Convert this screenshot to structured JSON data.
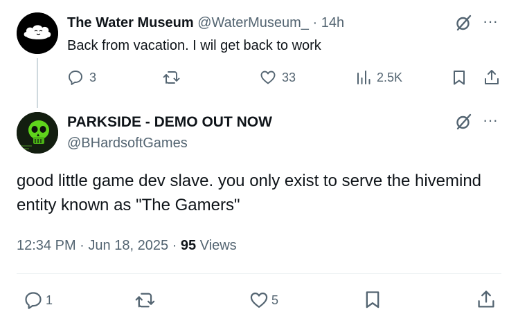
{
  "tweet1": {
    "display_name": "The Water Museum",
    "handle": "@WaterMuseum_",
    "separator": "·",
    "time": "14h",
    "text": "Back from vacation. I wil get back to work",
    "replies": "3",
    "likes": "33",
    "views": "2.5K",
    "icons": [
      "reply-icon",
      "retweet-icon",
      "like-icon",
      "views-icon",
      "bookmark-icon",
      "share-icon",
      "grok-icon",
      "more-icon"
    ]
  },
  "tweet2": {
    "display_name": "PARKSIDE - DEMO OUT NOW",
    "handle": "@BHardsoftGames",
    "text": "good little game dev slave. you only exist to serve the hivemind entity known as \"The Gamers\"",
    "time": "12:34 PM",
    "date": "Jun 18, 2025",
    "separator": "·",
    "views_count": "95",
    "views_label": "Views",
    "replies": "1",
    "likes": "5",
    "icons": [
      "reply-icon",
      "retweet-icon",
      "like-icon",
      "bookmark-icon",
      "share-icon",
      "grok-icon",
      "more-icon"
    ]
  },
  "colors": {
    "text_primary": "#0f1419",
    "text_secondary": "#536471",
    "thread_line": "#cfd9de",
    "avatar2_accent": "#5fd41c"
  }
}
